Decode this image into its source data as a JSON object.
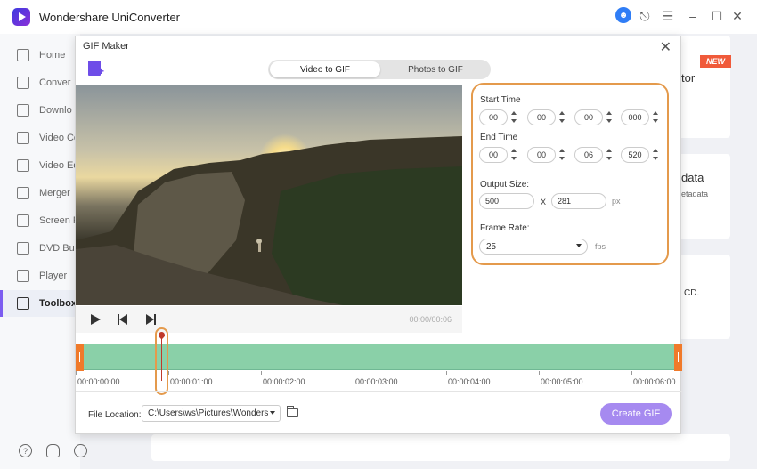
{
  "app": {
    "title": "Wondershare UniConverter"
  },
  "sidebar": {
    "items": [
      {
        "label": "Home"
      },
      {
        "label": "Conver"
      },
      {
        "label": "Downlo"
      },
      {
        "label": "Video Co"
      },
      {
        "label": "Video Ed"
      },
      {
        "label": "Merger"
      },
      {
        "label": "Screen R"
      },
      {
        "label": "DVD Bur"
      },
      {
        "label": "Player"
      },
      {
        "label": "Toolbox"
      }
    ]
  },
  "background": {
    "badge": "NEW",
    "card1_text": "tor",
    "card2_text": "data",
    "card2_sub": "etadata",
    "card3_text": "CD."
  },
  "dialog": {
    "title": "GIF Maker",
    "tabs": [
      {
        "label": "Video to GIF",
        "active": true
      },
      {
        "label": "Photos to GIF",
        "active": false
      }
    ],
    "player": {
      "time": "00:00/00:06"
    },
    "start_time": {
      "label": "Start Time",
      "h": "00",
      "m": "00",
      "s": "00",
      "ms": "000"
    },
    "end_time": {
      "label": "End Time",
      "h": "00",
      "m": "00",
      "s": "06",
      "ms": "520"
    },
    "output_size": {
      "label": "Output Size:",
      "width": "500",
      "separator": "X",
      "height": "281",
      "unit": "px"
    },
    "frame_rate": {
      "label": "Frame Rate:",
      "value": "25",
      "unit": "fps"
    },
    "timeline": {
      "playhead_fraction": 0.155,
      "ticks": [
        "00:00:00:00",
        "00:00:01:00",
        "00:00:02:00",
        "00:00:03:00",
        "00:00:04:00",
        "00:00:05:00",
        "00:00:06:00"
      ]
    },
    "file_location": {
      "label": "File Location:",
      "path": "C:\\Users\\ws\\Pictures\\Wonders"
    },
    "create_button": "Create GIF"
  },
  "colors": {
    "accent": "#7b5cf0",
    "highlight": "#e49a4c",
    "timeline": "#8ad0a8",
    "create_button": "#a68af0"
  }
}
